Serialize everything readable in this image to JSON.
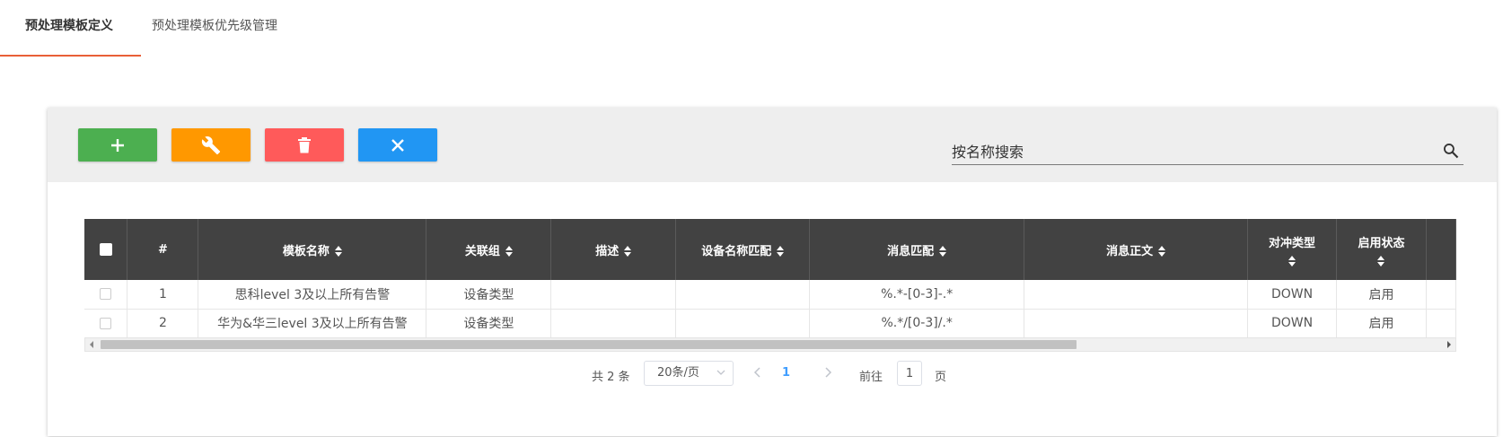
{
  "tabs": [
    {
      "label": "预处理模板定义",
      "active": true
    },
    {
      "label": "预处理模板优先级管理",
      "active": false
    }
  ],
  "toolbar": {
    "buttons": [
      {
        "name": "add",
        "icon": "plus-icon",
        "color": "#4caf50"
      },
      {
        "name": "edit",
        "icon": "wrench-icon",
        "color": "#ff9800"
      },
      {
        "name": "delete",
        "icon": "trash-icon",
        "color": "#ff5a5a"
      },
      {
        "name": "cancel",
        "icon": "close-icon",
        "color": "#2196f3"
      }
    ],
    "search_placeholder": "按名称搜索"
  },
  "table": {
    "columns": [
      {
        "key": "check",
        "label": ""
      },
      {
        "key": "index",
        "label": "#"
      },
      {
        "key": "name",
        "label": "模板名称"
      },
      {
        "key": "group",
        "label": "关联组"
      },
      {
        "key": "desc",
        "label": "描述"
      },
      {
        "key": "device_match",
        "label": "设备名称匹配"
      },
      {
        "key": "msg_match",
        "label": "消息匹配"
      },
      {
        "key": "msg_body",
        "label": "消息正文"
      },
      {
        "key": "offset_type",
        "label": "对冲类型"
      },
      {
        "key": "status",
        "label": "启用状态"
      }
    ],
    "rows": [
      {
        "index": "1",
        "name": "思科level 3及以上所有告警",
        "group": "设备类型",
        "desc": "",
        "device_match": "",
        "msg_match": "%.*-[0-3]-.*",
        "msg_body": "",
        "offset_type": "DOWN",
        "status": "启用"
      },
      {
        "index": "2",
        "name": "华为&华三level 3及以上所有告警",
        "group": "设备类型",
        "desc": "",
        "device_match": "",
        "msg_match": "%.*/[0-3]/.*",
        "msg_body": "",
        "offset_type": "DOWN",
        "status": "启用"
      }
    ]
  },
  "pagination": {
    "total": "共 2 条",
    "page_size": "20条/页",
    "current_page": "1",
    "goto_label": "前往",
    "goto_value": "1",
    "page_suffix": "页"
  },
  "colors": {
    "accent": "#e95f37",
    "header_bg": "#424242",
    "link": "#409eff"
  }
}
